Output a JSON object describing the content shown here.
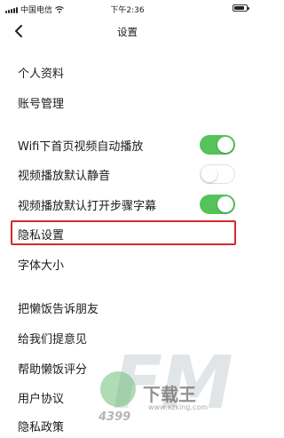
{
  "status_bar": {
    "carrier": "中国电信",
    "time": "下午2:36",
    "battery_level": 0.85
  },
  "nav": {
    "back_icon": "chevron-left-icon",
    "title": "设置"
  },
  "settings": {
    "profile": "个人资料",
    "account": "账号管理",
    "wifi_autoplay": {
      "label": "Wifi下首页视频自动播放",
      "enabled": true
    },
    "mute_default": {
      "label": "视频播放默认静音",
      "enabled": false
    },
    "step_subtitles": {
      "label": "视频播放默认打开步骤字幕",
      "enabled": true
    },
    "privacy_settings": "隐私设置",
    "font_size": "字体大小",
    "share": "把懒饭告诉朋友",
    "feedback": "给我们提意见",
    "rate": "帮助懒饭评分",
    "user_agreement": "用户协议",
    "privacy_policy": "隐私政策"
  },
  "colors": {
    "toggle_on": "#56c25a",
    "highlight_border": "#d9282b"
  },
  "watermark": {
    "brand": "FM",
    "site_name": "下载王",
    "url": "www.xzking.com",
    "logo_text": "4399"
  }
}
